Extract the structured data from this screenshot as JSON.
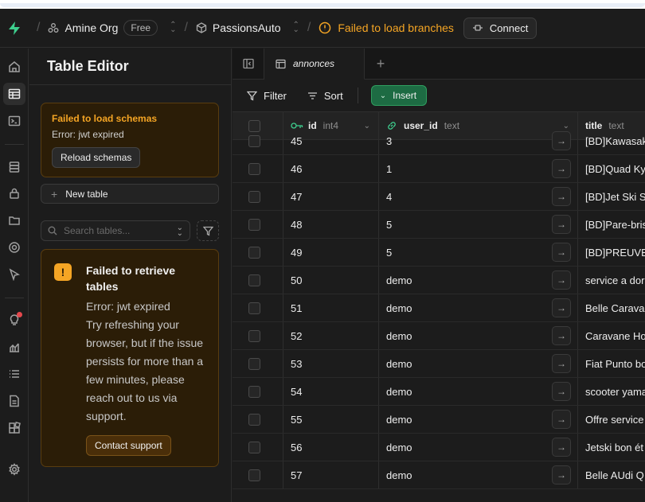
{
  "topbar": {
    "org_name": "Amine Org",
    "org_plan": "Free",
    "project_name": "PassionsAuto",
    "branch_error": "Failed to load branches",
    "connect_label": "Connect"
  },
  "panel": {
    "title": "Table Editor",
    "schema_error": {
      "title": "Failed to load schemas",
      "detail": "Error: jwt expired",
      "button": "Reload schemas"
    },
    "new_table_label": "New table",
    "search_placeholder": "Search tables...",
    "tables_error": {
      "title": "Failed to retrieve tables",
      "detail": "Error: jwt expired",
      "message": "Try refreshing your browser, but if the issue persists for more than a few minutes, please reach out to us via support.",
      "button": "Contact support"
    }
  },
  "tabs": {
    "active_tab": "annonces"
  },
  "toolbar": {
    "filter_label": "Filter",
    "sort_label": "Sort",
    "insert_label": "Insert"
  },
  "grid": {
    "columns": [
      {
        "name": "id",
        "type": "int4"
      },
      {
        "name": "user_id",
        "type": "text"
      },
      {
        "name": "title",
        "type": "text"
      }
    ],
    "rows": [
      {
        "id": "45",
        "user_id": "3",
        "title": "[BD]Kawasaki"
      },
      {
        "id": "46",
        "user_id": "1",
        "title": "[BD]Quad Ky"
      },
      {
        "id": "47",
        "user_id": "4",
        "title": "[BD]Jet Ski S"
      },
      {
        "id": "48",
        "user_id": "5",
        "title": "[BD]Pare-bris"
      },
      {
        "id": "49",
        "user_id": "5",
        "title": "[BD]PREUVE"
      },
      {
        "id": "50",
        "user_id": "demo",
        "title": "service a dor"
      },
      {
        "id": "51",
        "user_id": "demo",
        "title": "Belle Carava"
      },
      {
        "id": "52",
        "user_id": "demo",
        "title": "Caravane Ho"
      },
      {
        "id": "53",
        "user_id": "demo",
        "title": "Fiat Punto bo"
      },
      {
        "id": "54",
        "user_id": "demo",
        "title": "scooter yama"
      },
      {
        "id": "55",
        "user_id": "demo",
        "title": "Offre service"
      },
      {
        "id": "56",
        "user_id": "demo",
        "title": "Jetski bon ét"
      },
      {
        "id": "57",
        "user_id": "demo",
        "title": "Belle AUdi Q"
      }
    ]
  },
  "colors": {
    "accent_green": "#3ecf8e",
    "warning": "#f5a524",
    "insert_bg": "#1d6b43"
  }
}
